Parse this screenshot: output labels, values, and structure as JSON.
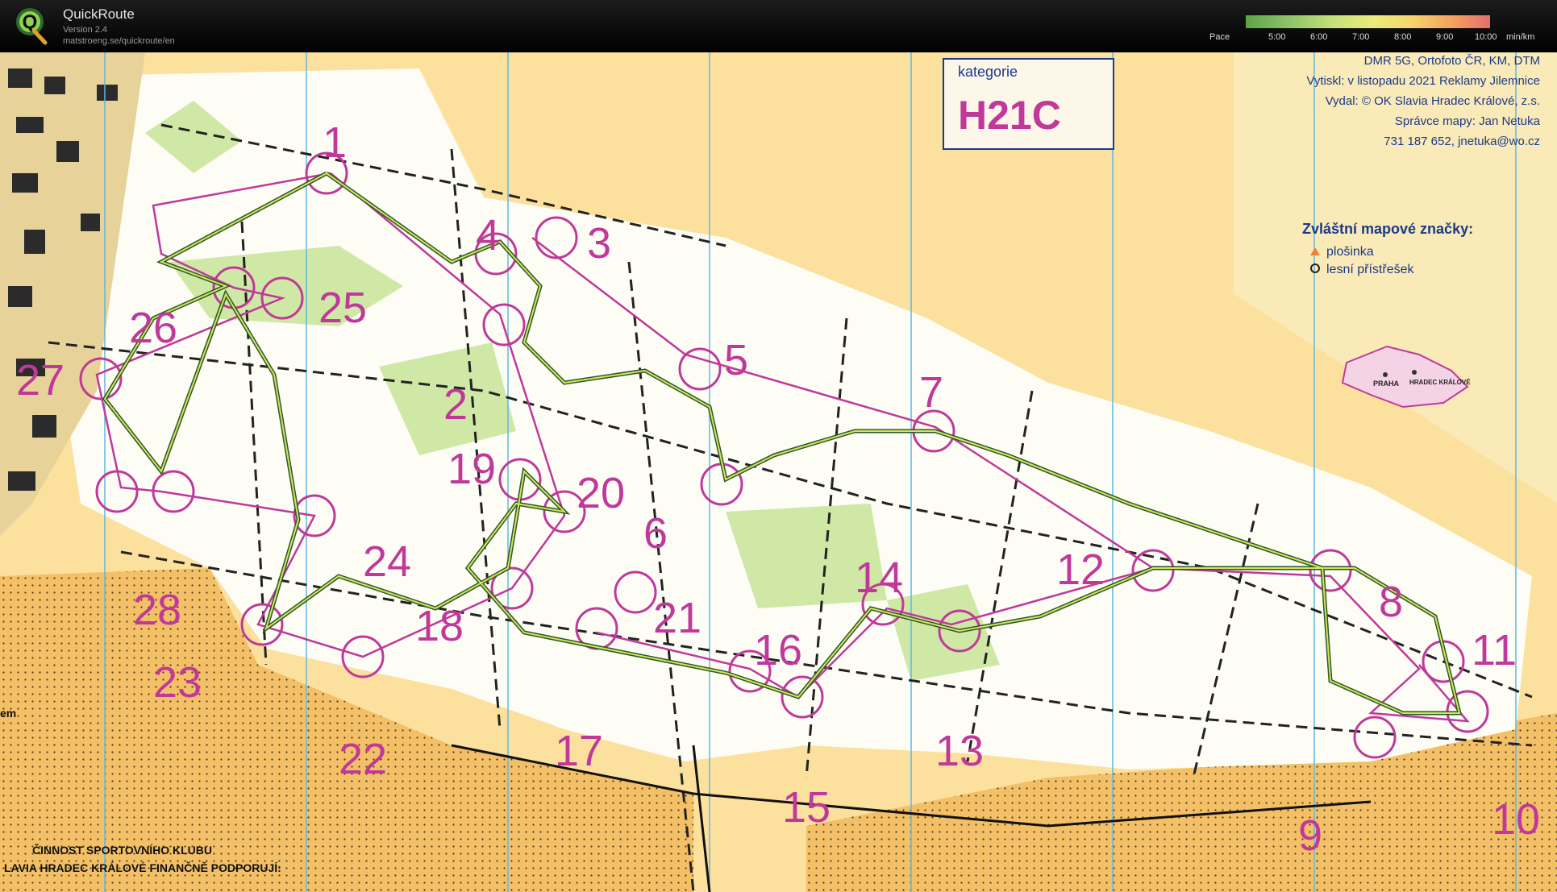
{
  "app": {
    "name": "QuickRoute",
    "version": "Version 2.4",
    "url": "matstroeng.se/quickroute/en",
    "logo_letter": "Q"
  },
  "pace_scale": {
    "label": "Pace",
    "ticks": [
      "5:00",
      "6:00",
      "7:00",
      "8:00",
      "9:00",
      "10:00"
    ],
    "unit": "min/km"
  },
  "map": {
    "category_label": "kategorie",
    "category_value": "H21C",
    "info_lines": [
      "DMR 5G, Ortofoto ČR, KM, DTM",
      "Vytiskl: v listopadu 2021 Reklamy Jilemnice",
      "Vydal:      © OK Slavia Hradec Králové, z.s.",
      "Správce mapy:                Jan Netuka",
      "731 187 652, jnetuka@wo.cz"
    ],
    "legend_title": "Zvláštní mapové značky:",
    "legend_items": [
      "plošinka",
      "lesní přístřešek"
    ],
    "inset_labels": [
      "PRAHA",
      "HRADEC KRÁLOVÉ"
    ],
    "footer_lines": [
      "ČINNOST SPORTOVNÍHO KLUBU",
      "LAVIA HRADEC KRÁLOVÉ FINANČNĚ PODPORUJÍ:"
    ],
    "edge_label": "em",
    "controls": [
      "1",
      "2",
      "3",
      "4",
      "5",
      "6",
      "7",
      "8",
      "9",
      "10",
      "11",
      "12",
      "13",
      "14",
      "15",
      "16",
      "17",
      "18",
      "19",
      "20",
      "21",
      "22",
      "23",
      "24",
      "25",
      "26",
      "27",
      "28"
    ]
  },
  "colors": {
    "open_land": "#f4c067",
    "rough_open": "#fbe19d",
    "forest": "#ffffff",
    "green": "#bfe08e",
    "course": "#c0399a",
    "route_dark": "#2a5a2a",
    "route_light": "#d6e35a"
  }
}
